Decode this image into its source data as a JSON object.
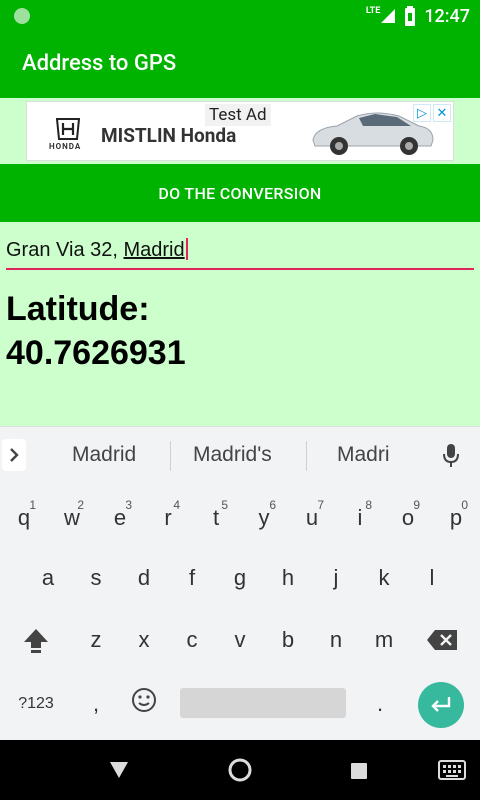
{
  "status_bar": {
    "network": "LTE",
    "time": "12:47"
  },
  "app_bar": {
    "title": "Address to GPS"
  },
  "ad": {
    "label": "Test Ad",
    "honda_wordmark": "HONDA",
    "brand_text": "MISTLIN Honda"
  },
  "convert_button": {
    "label": "DO THE CONVERSION"
  },
  "address_input": {
    "value_prefix": "Gran Via 32, ",
    "value_underlined": "Madrid"
  },
  "result": {
    "latitude_label": "Latitude:",
    "latitude_value": "40.7626931"
  },
  "suggestions": [
    "Madrid",
    "Madrid's",
    "Madri"
  ],
  "keyboard": {
    "row1": [
      {
        "key": "q",
        "hint": "1"
      },
      {
        "key": "w",
        "hint": "2"
      },
      {
        "key": "e",
        "hint": "3"
      },
      {
        "key": "r",
        "hint": "4"
      },
      {
        "key": "t",
        "hint": "5"
      },
      {
        "key": "y",
        "hint": "6"
      },
      {
        "key": "u",
        "hint": "7"
      },
      {
        "key": "i",
        "hint": "8"
      },
      {
        "key": "o",
        "hint": "9"
      },
      {
        "key": "p",
        "hint": "0"
      }
    ],
    "row2": [
      "a",
      "s",
      "d",
      "f",
      "g",
      "h",
      "j",
      "k",
      "l"
    ],
    "row3": [
      "z",
      "x",
      "c",
      "v",
      "b",
      "n",
      "m"
    ],
    "symbols_label": "?123",
    "comma": ",",
    "period": "."
  },
  "colors": {
    "primary": "#00b300",
    "background": "#ccffcc",
    "input_underline": "#e0245e",
    "enter_key": "#36b99c"
  },
  "icons": {
    "status_left": "notification-dot-icon",
    "signal": "signal-icon",
    "battery": "battery-icon",
    "expand": "chevron-right-icon",
    "mic": "mic-icon",
    "shift": "shift-icon",
    "backspace": "backspace-icon",
    "emoji": "emoji-icon",
    "enter": "enter-icon",
    "nav_back": "back-icon",
    "nav_home": "home-icon",
    "nav_recents": "recents-icon",
    "nav_keyboard": "keyboard-icon"
  }
}
